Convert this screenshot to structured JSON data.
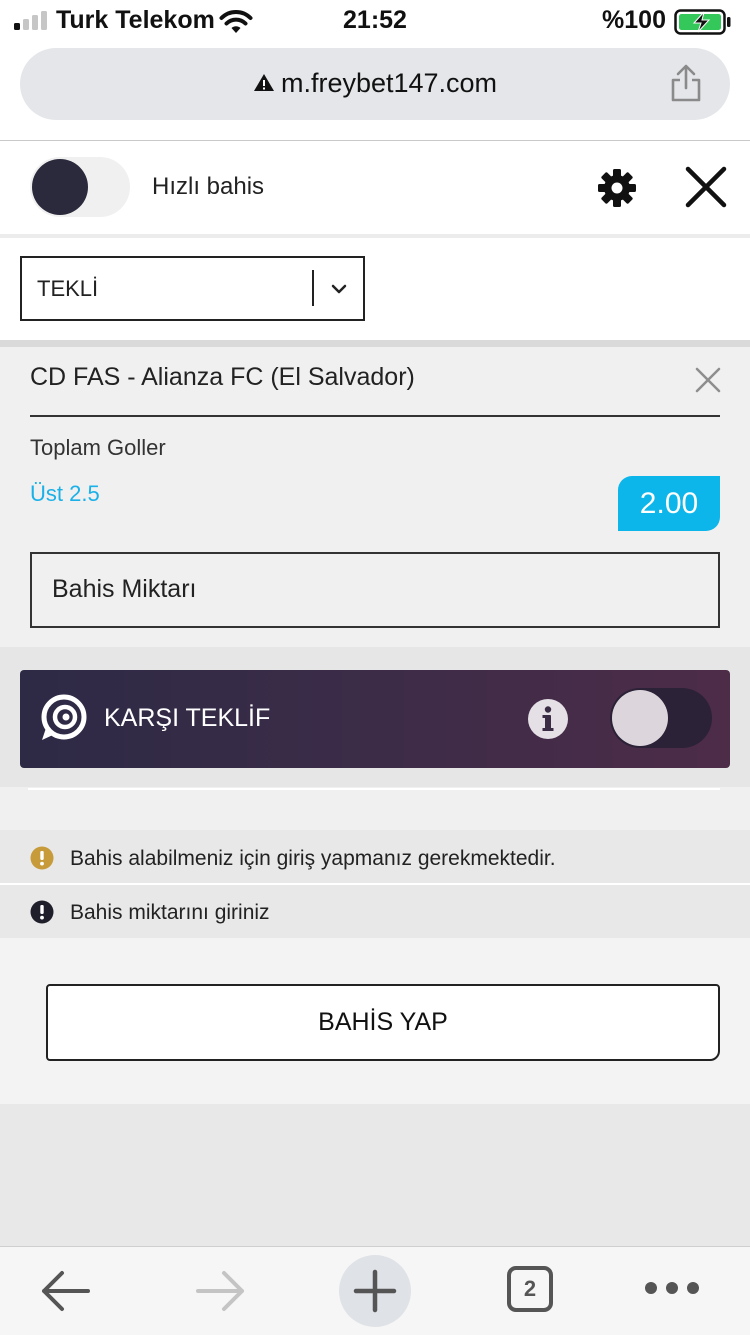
{
  "status_bar": {
    "carrier": "Turk Telekom",
    "time": "21:52",
    "battery": "%100"
  },
  "browser": {
    "url": "m.freybet147.com",
    "tabs_count": "2"
  },
  "betslip": {
    "quick_bet_label": "Hızlı bahis",
    "bet_type": "TEKLİ",
    "match": "CD FAS - Alianza FC (El Salvador)",
    "market": "Toplam Goller",
    "selection": "Üst 2.5",
    "odds": "2.00",
    "stake_placeholder": "Bahis Miktarı",
    "counter_offer_label": "KARŞI TEKLİF",
    "messages": [
      {
        "type": "warning",
        "text": "Bahis alabilmeniz için giriş yapmanız gerekmektedir."
      },
      {
        "type": "error",
        "text": "Bahis miktarını giriniz"
      }
    ],
    "place_bet_label": "BAHİS YAP"
  },
  "colors": {
    "accent": "#0cb6ea",
    "warning": "#c79a3a",
    "counter_bg_start": "#2d2a45",
    "counter_bg_end": "#4d2c48"
  }
}
